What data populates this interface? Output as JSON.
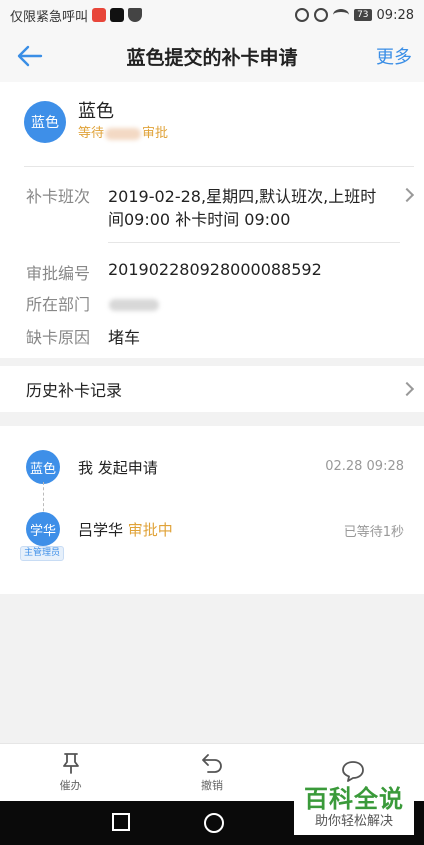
{
  "status_bar": {
    "left_text": "仅限紧急呼叫",
    "battery": "73",
    "time": "09:28"
  },
  "header": {
    "title": "蓝色提交的补卡申请",
    "more_label": "更多"
  },
  "applicant": {
    "avatar_text": "蓝色",
    "name": "蓝色",
    "status_prefix": "等待",
    "status_suffix": "审批"
  },
  "details": {
    "shift": {
      "label": "补卡班次",
      "line1": "2019-02-28,星期四,默认班次,上班时",
      "line2": "间09:00 补卡时间 09:00"
    },
    "approval_no": {
      "label": "审批编号",
      "value": "201902280928000088592"
    },
    "department": {
      "label": "所在部门"
    },
    "reason": {
      "label": "缺卡原因",
      "value": "堵车"
    }
  },
  "history": {
    "label": "历史补卡记录"
  },
  "timeline": [
    {
      "avatar_text": "蓝色",
      "name": "我",
      "action": "发起申请",
      "time": "02.28 09:28"
    },
    {
      "avatar_text": "学华",
      "name": "吕学华",
      "action": "审批中",
      "time": "已等待1秒",
      "badge": "主管理员"
    }
  ],
  "actions": [
    {
      "icon": "pin-icon",
      "label": "催办"
    },
    {
      "icon": "undo-icon",
      "label": "撤销"
    },
    {
      "icon": "comment-icon",
      "label": ""
    }
  ],
  "watermark": {
    "title": "百科全说",
    "subtitle": "助你轻松解决"
  },
  "colors": {
    "accent": "#3a8ee6",
    "avatar": "#3e8fe8",
    "pending": "#e0a33a"
  }
}
